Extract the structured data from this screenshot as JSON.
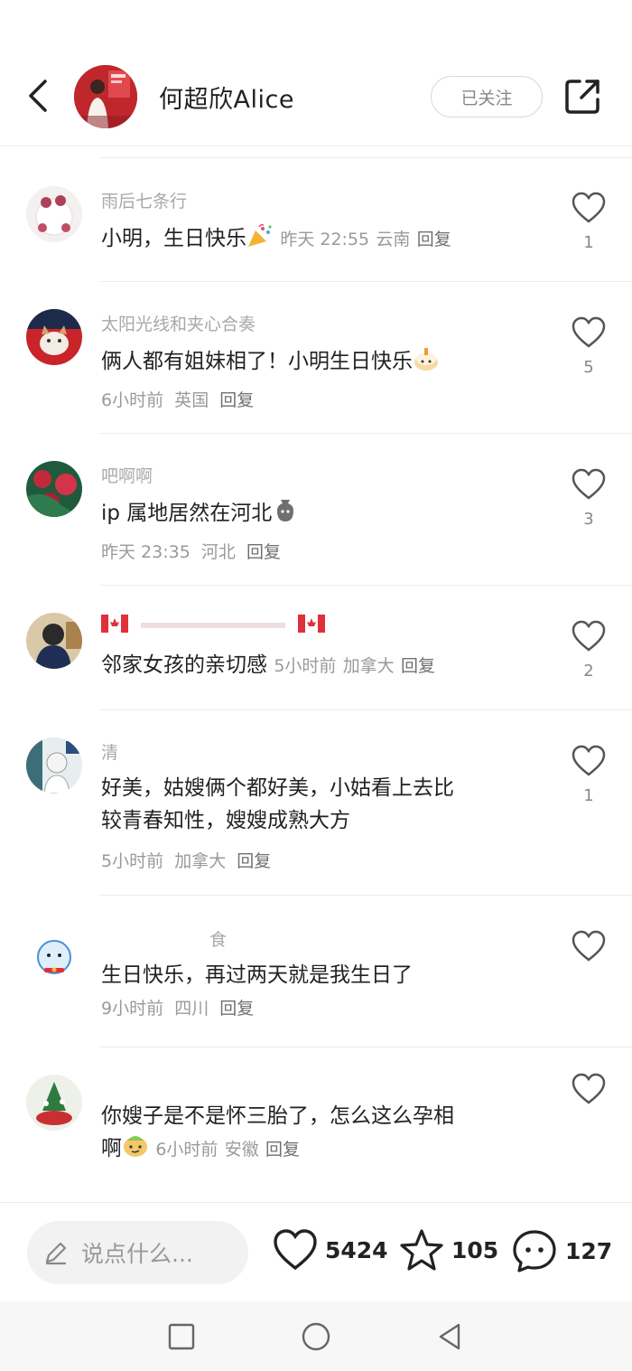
{
  "header": {
    "title": "何超欣Alice",
    "follow_label": "已关注"
  },
  "comments": [
    {
      "user": "雨后七条行",
      "text": "小明，生日快乐",
      "emoji": "party-popper",
      "time": "昨天 22:55",
      "location": "云南",
      "reply": "回复",
      "likes": "1"
    },
    {
      "user": "太阳光线和夹心合奏",
      "text": "俩人都有姐妹相了！小明生日快乐",
      "emoji": "cake",
      "time": "6小时前",
      "location": "英国",
      "reply": "回复",
      "likes": "5"
    },
    {
      "user": "吧啊啊",
      "text": "ip 属地居然在河北",
      "emoji": "money-bag",
      "time": "昨天 23:35",
      "location": "河北",
      "reply": "回复",
      "likes": "3"
    },
    {
      "user": "",
      "text": "邻家女孩的亲切感",
      "emoji": "",
      "time": "5小时前",
      "location": "加拿大",
      "reply": "回复",
      "likes": "2"
    },
    {
      "user": "清",
      "text_line1": "好美，姑嫂俩个都好美，小姑看上去比",
      "text_line2": "较青春知性，嫂嫂成熟大方",
      "time": "5小时前",
      "location": "加拿大",
      "reply": "回复",
      "likes": "1"
    },
    {
      "user": "食",
      "text": "生日快乐，再过两天就是我生日了",
      "time": "9小时前",
      "location": "四川",
      "reply": "回复",
      "likes": ""
    },
    {
      "user": "",
      "text_line1": "你嫂子是不是怀三胎了，怎么这么孕相",
      "text_line2": "啊",
      "emoji": "smirk",
      "time": "6小时前",
      "location": "安徽",
      "reply": "回复",
      "likes": ""
    }
  ],
  "bottom": {
    "input_placeholder": "说点什么...",
    "likes": "5424",
    "favorites": "105",
    "comments": "127"
  },
  "colors": {
    "text": "#222222",
    "meta": "#9a9a9a",
    "divider": "#ededed",
    "input_bg": "#f2f2f2"
  }
}
